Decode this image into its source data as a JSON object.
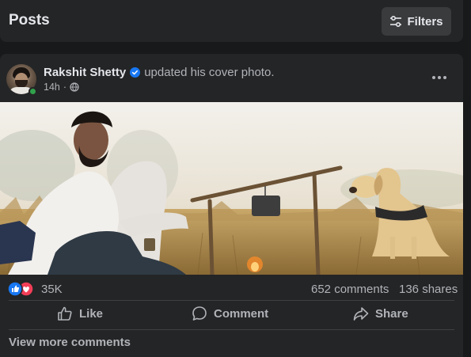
{
  "header": {
    "title": "Posts",
    "filters_label": "Filters"
  },
  "post": {
    "author": "Rakshit Shetty",
    "action": "updated his cover photo.",
    "time": "14h",
    "separator": "·",
    "reaction_count": "35K",
    "comments": "652 comments",
    "shares": "136 shares"
  },
  "actions": {
    "like": "Like",
    "comment": "Comment",
    "share": "Share"
  },
  "footer": {
    "view_more": "View more comments"
  },
  "colors": {
    "background": "#18191a",
    "card": "#242526",
    "text_primary": "#e4e6eb",
    "text_secondary": "#b0b3b8",
    "verified_blue": "#1877f2",
    "online_green": "#31a24c",
    "like_blue": "#1877f2",
    "love_red": "#f33e58"
  },
  "icons": [
    "filters-icon",
    "verified-icon",
    "globe-icon",
    "more-icon",
    "like-reaction-icon",
    "love-reaction-icon",
    "like-icon",
    "comment-icon",
    "share-icon"
  ]
}
